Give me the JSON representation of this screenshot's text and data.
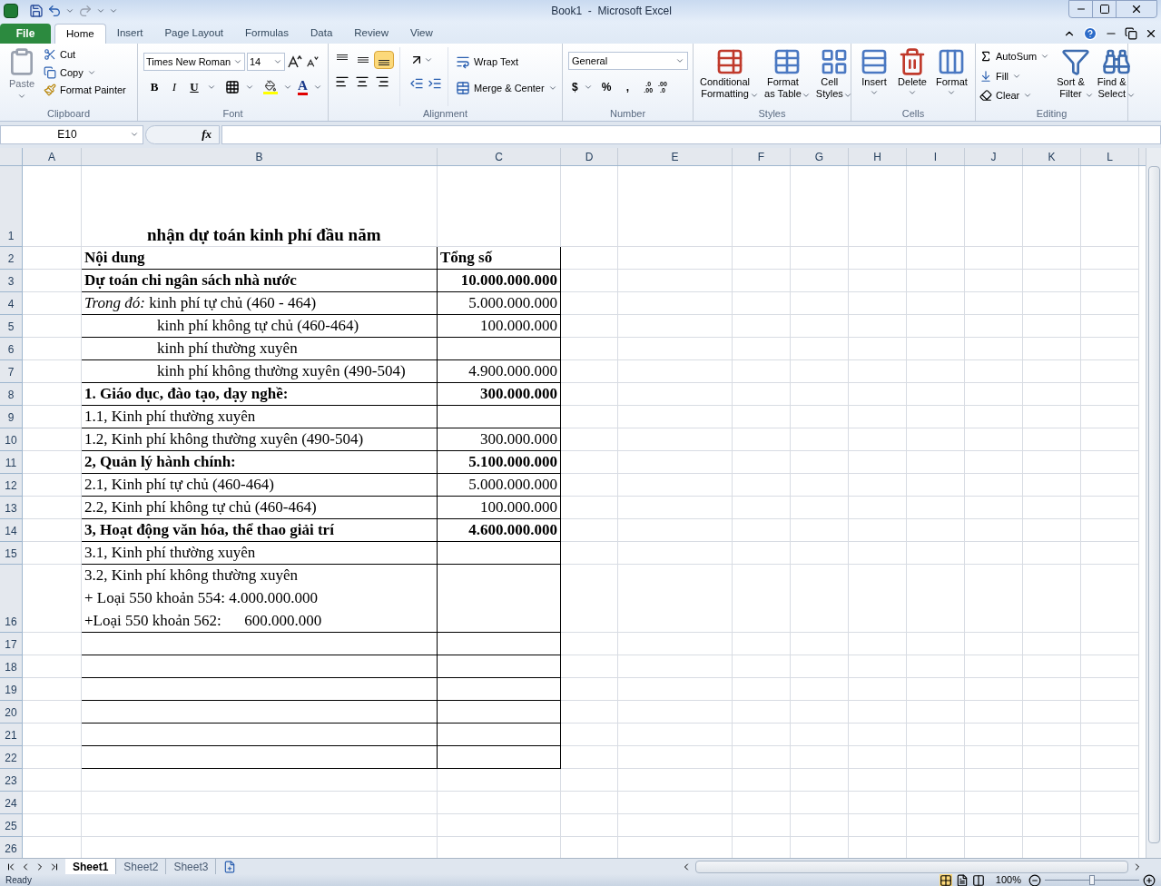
{
  "window": {
    "title": "Book1  -  Microsoft Excel"
  },
  "tabs": [
    {
      "label": "File",
      "kind": "file",
      "selected": false
    },
    {
      "label": "Home",
      "kind": "tab",
      "selected": true
    },
    {
      "label": "Insert",
      "kind": "tab",
      "selected": false
    },
    {
      "label": "Page Layout",
      "kind": "tab",
      "selected": false
    },
    {
      "label": "Formulas",
      "kind": "tab",
      "selected": false
    },
    {
      "label": "Data",
      "kind": "tab",
      "selected": false
    },
    {
      "label": "Review",
      "kind": "tab",
      "selected": false
    },
    {
      "label": "View",
      "kind": "tab",
      "selected": false
    }
  ],
  "ribbon": {
    "clipboard": {
      "label": "Clipboard",
      "paste": "Paste",
      "cut": "Cut",
      "copy": "Copy",
      "format_painter": "Format Painter"
    },
    "font": {
      "label": "Font",
      "family": "Times New Roman",
      "size": "14",
      "bold": "B",
      "italic": "I",
      "underline": "U",
      "color_letter": "A"
    },
    "alignment": {
      "label": "Alignment",
      "wrap": "Wrap Text",
      "merge": "Merge & Center",
      "vertical": [
        {
          "selected": false
        },
        {
          "selected": false
        },
        {
          "selected": true
        }
      ]
    },
    "number": {
      "label": "Number",
      "format": "General",
      "currency": "$",
      "percent": "%",
      "comma": ",",
      "increase_decimal": [
        ".0",
        ".00"
      ],
      "decrease_decimal": [
        ".00",
        ".0"
      ]
    },
    "styles": {
      "label": "Styles",
      "buttons": [
        {
          "label": "Conditional\nFormatting",
          "kind": "conditional"
        },
        {
          "label": "Format\nas Table",
          "kind": "table"
        },
        {
          "label": "Cell\nStyles",
          "kind": "cell"
        }
      ]
    },
    "cells": {
      "label": "Cells",
      "buttons": [
        {
          "label": "Insert",
          "kind": "insert"
        },
        {
          "label": "Delete",
          "kind": "delete"
        },
        {
          "label": "Format",
          "kind": "format"
        }
      ]
    },
    "editing": {
      "label": "Editing",
      "autosum": "AutoSum",
      "fill": "Fill",
      "clear": "Clear",
      "sort": "Sort &\nFilter",
      "find": "Find &\nSelect"
    }
  },
  "formula_bar": {
    "name_box": "E10",
    "fx": "fx"
  },
  "columns": [
    "A",
    "B",
    "C",
    "D",
    "E",
    "F",
    "G",
    "H",
    "I",
    "J",
    "K",
    "L"
  ],
  "rows": [
    {
      "number": "1",
      "bordered": false,
      "b": {
        "text": "nhận dự toán kinh phí đầu năm",
        "bold": true,
        "kind": "title"
      }
    },
    {
      "number": "2",
      "bordered": true,
      "b": {
        "text": "Nội dung",
        "bold": true
      },
      "c": {
        "text": "Tổng số",
        "bold": true,
        "kind": "text"
      }
    },
    {
      "number": "3",
      "bordered": true,
      "b": {
        "text": "Dự toán chi ngân sách nhà nước",
        "bold": true
      },
      "c": {
        "text": "10.000.000.000",
        "bold": true,
        "kind": "number"
      }
    },
    {
      "number": "4",
      "bordered": true,
      "b": {
        "text": "*Trong đó:* kinh phí tự chủ (460 - 464)",
        "bold": false
      },
      "c": {
        "text": "5.000.000.000",
        "bold": false,
        "kind": "number"
      }
    },
    {
      "number": "5",
      "bordered": true,
      "b": {
        "text": "kinh phí không tự chủ (460-464)",
        "bold": false,
        "indented": true
      },
      "c": {
        "text": "100.000.000",
        "bold": false,
        "kind": "number"
      }
    },
    {
      "number": "6",
      "bordered": true,
      "b": {
        "text": "kinh phí thường xuyên",
        "bold": false,
        "indented": true
      }
    },
    {
      "number": "7",
      "bordered": true,
      "b": {
        "text": "kinh phí không thường xuyên (490-504)",
        "bold": false,
        "indented": true
      },
      "c": {
        "text": "4.900.000.000",
        "bold": false,
        "kind": "number"
      }
    },
    {
      "number": "8",
      "bordered": true,
      "b": {
        "text": "1. Giáo dục, đào tạo, dạy nghề:",
        "bold": true
      },
      "c": {
        "text": "300.000.000",
        "bold": true,
        "kind": "number"
      }
    },
    {
      "number": "9",
      "bordered": true,
      "b": {
        "text": "1.1, Kinh phí thường xuyên",
        "bold": false
      }
    },
    {
      "number": "10",
      "bordered": true,
      "b": {
        "text": "1.2, Kinh phí không thường xuyên (490-504)",
        "bold": false
      },
      "c": {
        "text": "300.000.000",
        "bold": false,
        "kind": "number"
      }
    },
    {
      "number": "11",
      "bordered": true,
      "b": {
        "text": "2, Quản lý hành chính:",
        "bold": true
      },
      "c": {
        "text": "5.100.000.000",
        "bold": true,
        "kind": "number"
      }
    },
    {
      "number": "12",
      "bordered": true,
      "b": {
        "text": "2.1, Kinh phí tự chủ (460-464)",
        "bold": false
      },
      "c": {
        "text": "5.000.000.000",
        "bold": false,
        "kind": "number"
      }
    },
    {
      "number": "13",
      "bordered": true,
      "b": {
        "text": "2.2, Kinh phí không tự chủ (460-464)",
        "bold": false
      },
      "c": {
        "text": "100.000.000",
        "bold": false,
        "kind": "number"
      }
    },
    {
      "number": "14",
      "bordered": true,
      "b": {
        "text": "3, Hoạt động văn hóa, thể thao giải trí",
        "bold": true
      },
      "c": {
        "text": "4.600.000.000",
        "bold": true,
        "kind": "number"
      }
    },
    {
      "number": "15",
      "bordered": true,
      "b": {
        "text": "3.1, Kinh phí thường xuyên",
        "bold": false
      }
    },
    {
      "number": "16",
      "bordered": true,
      "b": {
        "text": "3.2, Kinh phí không thường xuyên\n+ Loại 550 khoản 554: 4.000.000.000\n+Loại 550 khoản 562:      600.000.000",
        "bold": false
      }
    },
    {
      "number": "17",
      "bordered": true
    },
    {
      "number": "18",
      "bordered": true
    },
    {
      "number": "19",
      "bordered": true
    },
    {
      "number": "20",
      "bordered": true
    },
    {
      "number": "21",
      "bordered": true
    },
    {
      "number": "22",
      "bordered": true
    },
    {
      "number": "23",
      "bordered": false
    },
    {
      "number": "24",
      "bordered": false
    },
    {
      "number": "25",
      "bordered": false
    },
    {
      "number": "26",
      "bordered": false
    }
  ],
  "sheets": [
    {
      "label": "Sheet1",
      "selected": true
    },
    {
      "label": "Sheet2",
      "selected": false
    },
    {
      "label": "Sheet3",
      "selected": false
    }
  ],
  "status_bar": {
    "text": "Ready",
    "zoom": "100%",
    "zoom_slider": {
      "level": 0.5
    }
  }
}
